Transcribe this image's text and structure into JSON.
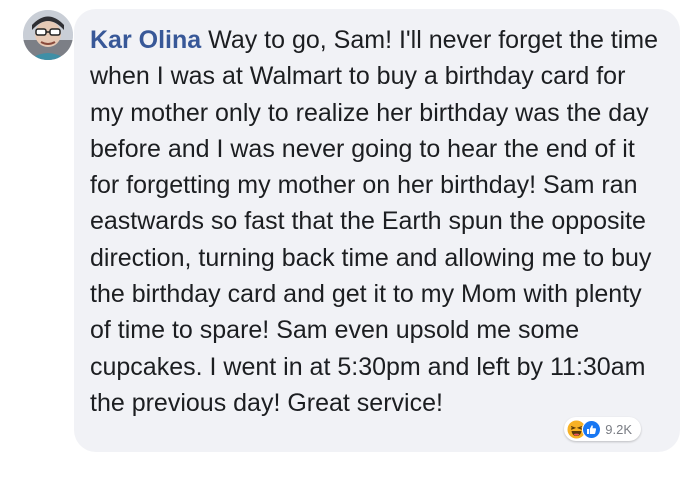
{
  "comment": {
    "author": "Kar Olina",
    "text": "Way to go, Sam! I'll never forget the time when I was at Walmart to buy a birthday card for my mother only to realize her birthday was the day before and I was never going to hear the end of it for forgetting my mother on her birthday! Sam ran eastwards so fast that the Earth spun the opposite direction, turning back time and allowing me to buy the birthday card and get it to my Mom with plenty of time to spare! Sam even upsold me some cupcakes. I went in at 5:30pm and left by 11:30am the previous day! Great service!",
    "reactions": {
      "icons": [
        "haha-icon",
        "like-icon"
      ],
      "count": "9.2K"
    }
  },
  "colors": {
    "bubble": "#f1f2f6",
    "author": "#385898",
    "text": "#1c1e21",
    "like": "#1877f2",
    "haha": "#f7b125"
  }
}
